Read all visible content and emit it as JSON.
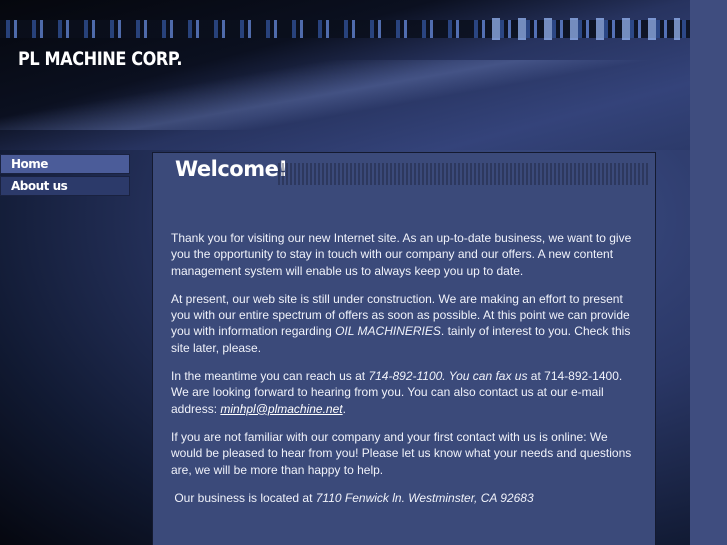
{
  "header": {
    "logo": "PL MACHINE CORP."
  },
  "nav": [
    {
      "label": "Home"
    },
    {
      "label": "About us"
    }
  ],
  "main": {
    "title": "Welcome!",
    "p1": "Thank you for visiting our new Internet site. As an up-to-date business, we want to give you the opportunity to stay in touch with our company and our offers. A new content management system will enable us to always keep you up to date.",
    "p2a": "At present, our web site is still under construction. We are making an effort to present you with our entire spectrum of offers as soon as possible. At this point we can provide you with information regarding ",
    "p2b": "OIL MACHINERIES",
    "p2c": ". tainly of interest to you. Check this site later, please.",
    "p3a": "In the meantime you can reach us at ",
    "p3b": "714-892-1100. You can fax us",
    "p3c": " at 714-892-1400. We are looking forward to hearing from you. You can also contact us at our e-mail address: ",
    "email": "minhpl@plmachine.net",
    "p3d": ".",
    "p4": "If you are not familiar with our company and your first contact with us is online: We would be pleased to hear from you! Please let us know what your needs and questions are, we will be more than happy to help.",
    "p5a": " Our business is located at ",
    "p5b": "7110 Fenwick ln. Westminster, CA 92683"
  }
}
